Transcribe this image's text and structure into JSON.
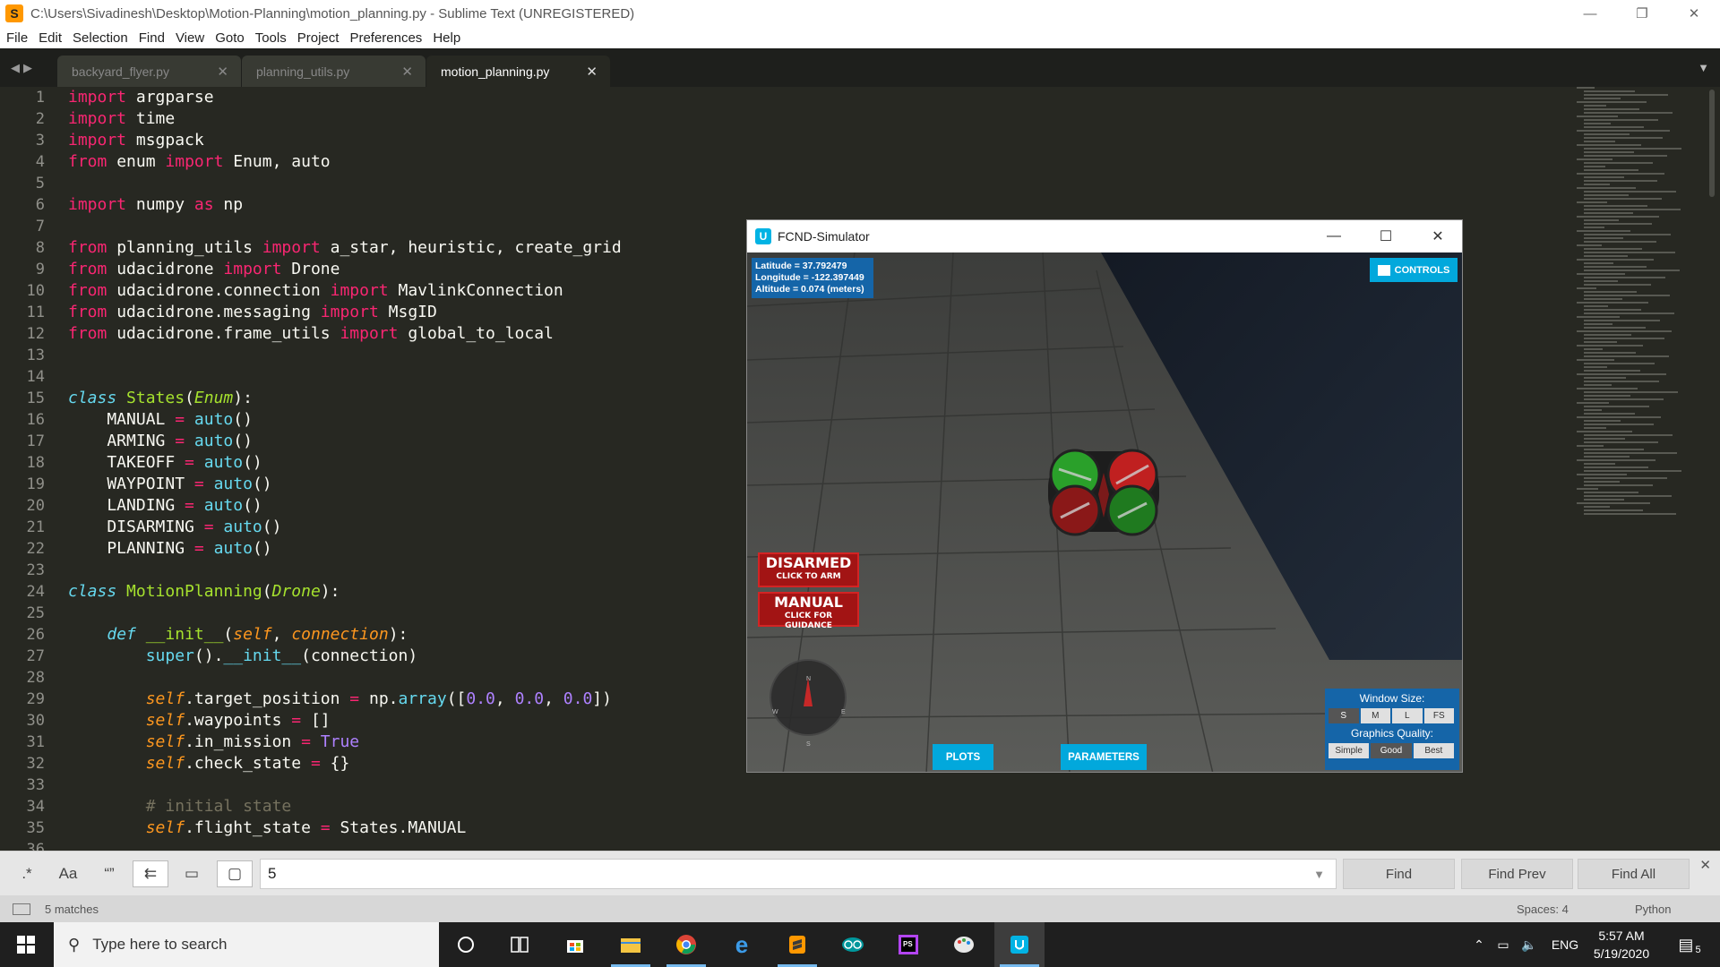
{
  "window": {
    "title": "C:\\Users\\Sivadinesh\\Desktop\\Motion-Planning\\motion_planning.py - Sublime Text (UNREGISTERED)",
    "minimize": "—",
    "maximize": "❐",
    "close": "✕"
  },
  "menu": [
    "File",
    "Edit",
    "Selection",
    "Find",
    "View",
    "Goto",
    "Tools",
    "Project",
    "Preferences",
    "Help"
  ],
  "tabs": [
    {
      "label": "backyard_flyer.py",
      "close": "✕"
    },
    {
      "label": "planning_utils.py",
      "close": "✕"
    },
    {
      "label": "motion_planning.py",
      "close": "✕"
    }
  ],
  "editor": {
    "line_numbers": [
      "1",
      "2",
      "3",
      "4",
      "5",
      "6",
      "7",
      "8",
      "9",
      "10",
      "11",
      "12",
      "13",
      "14",
      "15",
      "16",
      "17",
      "18",
      "19",
      "20",
      "21",
      "22",
      "23",
      "24",
      "25",
      "26",
      "27",
      "28",
      "29",
      "30",
      "31",
      "32",
      "33",
      "34",
      "35",
      "36"
    ]
  },
  "find": {
    "value": "5",
    "regex_label": ".*",
    "case_label": "Aa",
    "word_label": "“”",
    "find_label": "Find",
    "find_prev_label": "Find Prev",
    "find_all_label": "Find All"
  },
  "status": {
    "matches": "5 matches",
    "spaces": "Spaces: 4",
    "syntax": "Python"
  },
  "simulator": {
    "title": "FCND-Simulator",
    "latitude": "Latitude = 37.792479",
    "longitude": "Longitude = -122.397449",
    "altitude": "Altitude = 0.074 (meters)",
    "controls": "CONTROLS",
    "disarmed": "DISARMED",
    "click_to_arm": "CLICK TO ARM",
    "manual": "MANUAL",
    "click_for_guidance": "CLICK FOR GUIDANCE",
    "plots": "PLOTS",
    "parameters": "PARAMETERS",
    "window_size_label": "Window Size:",
    "window_sizes": [
      "S",
      "M",
      "L",
      "FS"
    ],
    "graphics_quality_label": "Graphics Quality:",
    "qualities": [
      "Simple",
      "Good",
      "Best"
    ],
    "compass": {
      "n": "N",
      "w": "W",
      "e": "E",
      "s": "S"
    }
  },
  "taskbar": {
    "search_placeholder": "Type here to search",
    "language": "ENG",
    "time": "5:57 AM",
    "date": "5/19/2020",
    "notifications": "5",
    "icons": [
      "cortana-icon",
      "task-view-icon",
      "store-icon",
      "file-explorer-icon",
      "chrome-icon",
      "edge-icon",
      "sublime-icon",
      "arduino-icon",
      "phpstorm-icon",
      "paint-icon",
      "udacity-sim-icon"
    ]
  },
  "colors": {
    "editor_bg": "#272822",
    "keyword": "#f92672",
    "function": "#a6e22e",
    "builtin": "#66d9ef",
    "number": "#ae81ff",
    "param": "#fd971f",
    "comment": "#75715e",
    "sim_accent": "#02a8dc",
    "sim_panel": "#1565a8",
    "disarmed_red": "#a21414"
  }
}
